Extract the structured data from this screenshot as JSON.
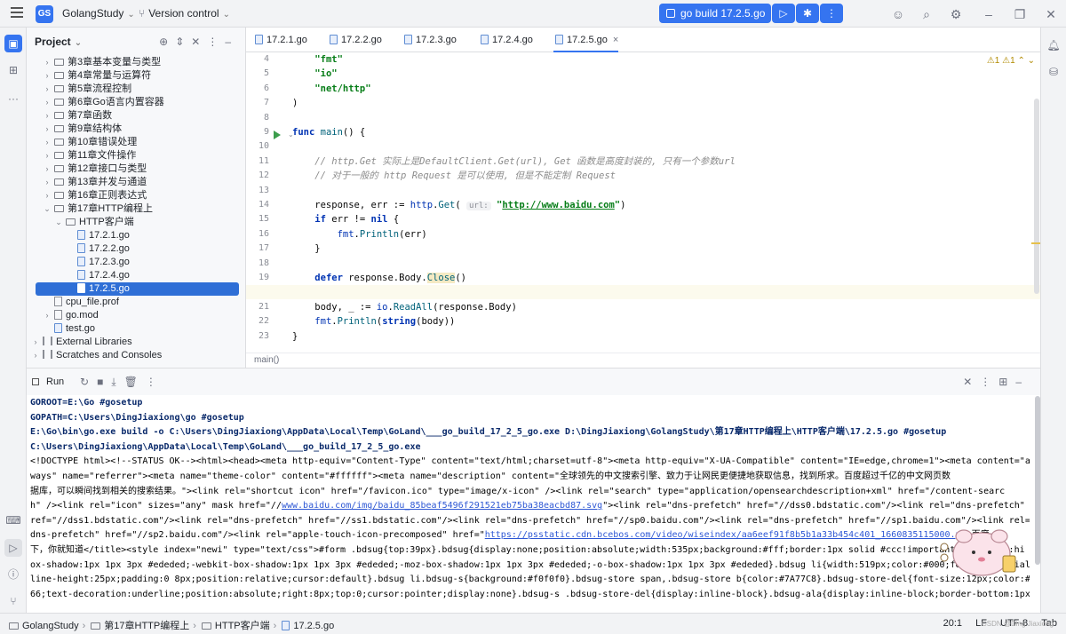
{
  "topbar": {
    "project_badge": "GS",
    "project_name": "GolangStudy",
    "vcs": "Version control",
    "run_config": "go build 17.2.5.go"
  },
  "icons": {
    "menu": "hamburger-icon",
    "run": "play-icon",
    "debug": "bug-icon",
    "more": "kebab-icon",
    "user": "user-icon",
    "search": "search-icon",
    "settings": "gear-icon"
  },
  "project_panel": {
    "title": "Project",
    "tree": [
      {
        "depth": 1,
        "arrow": "›",
        "kind": "folder",
        "label": "第3章基本变量与类型"
      },
      {
        "depth": 1,
        "arrow": "›",
        "kind": "folder",
        "label": "第4章常量与运算符"
      },
      {
        "depth": 1,
        "arrow": "›",
        "kind": "folder",
        "label": "第5章流程控制"
      },
      {
        "depth": 1,
        "arrow": "›",
        "kind": "folder",
        "label": "第6章Go语言内置容器"
      },
      {
        "depth": 1,
        "arrow": "›",
        "kind": "folder",
        "label": "第7章函数"
      },
      {
        "depth": 1,
        "arrow": "›",
        "kind": "folder",
        "label": "第9章结构体"
      },
      {
        "depth": 1,
        "arrow": "›",
        "kind": "folder",
        "label": "第10章错误处理"
      },
      {
        "depth": 1,
        "arrow": "›",
        "kind": "folder",
        "label": "第11章文件操作"
      },
      {
        "depth": 1,
        "arrow": "›",
        "kind": "folder",
        "label": "第12章接口与类型"
      },
      {
        "depth": 1,
        "arrow": "›",
        "kind": "folder",
        "label": "第13章并发与通道"
      },
      {
        "depth": 1,
        "arrow": "›",
        "kind": "folder",
        "label": "第16章正则表达式"
      },
      {
        "depth": 1,
        "arrow": "⌄",
        "kind": "folder",
        "label": "第17章HTTP编程上"
      },
      {
        "depth": 2,
        "arrow": "⌄",
        "kind": "folder",
        "label": "HTTP客户端"
      },
      {
        "depth": 3,
        "arrow": "",
        "kind": "go",
        "label": "17.2.1.go"
      },
      {
        "depth": 3,
        "arrow": "",
        "kind": "go",
        "label": "17.2.2.go"
      },
      {
        "depth": 3,
        "arrow": "",
        "kind": "go",
        "label": "17.2.3.go"
      },
      {
        "depth": 3,
        "arrow": "",
        "kind": "go",
        "label": "17.2.4.go"
      },
      {
        "depth": 3,
        "arrow": "",
        "kind": "go",
        "label": "17.2.5.go",
        "selected": true
      },
      {
        "depth": 1,
        "arrow": "",
        "kind": "doc",
        "label": "cpu_file.prof"
      },
      {
        "depth": 1,
        "arrow": "›",
        "kind": "doc",
        "label": "go.mod"
      },
      {
        "depth": 1,
        "arrow": "",
        "kind": "go",
        "label": "test.go"
      },
      {
        "depth": 0,
        "arrow": "›",
        "kind": "lib",
        "label": "External Libraries"
      },
      {
        "depth": 0,
        "arrow": "›",
        "kind": "lib",
        "label": "Scratches and Consoles"
      }
    ]
  },
  "editor": {
    "tabs": [
      "17.2.1.go",
      "17.2.2.go",
      "17.2.3.go",
      "17.2.4.go",
      "17.2.5.go"
    ],
    "active_tab": 4,
    "tab_close": "×",
    "warnings": "⚠1  ⚠1  ⌃  ⌄",
    "line_numbers": [
      "4",
      "5",
      "6",
      "7",
      "8",
      "9",
      "10",
      "11",
      "12",
      "13",
      "14",
      "15",
      "16",
      "17",
      "18",
      "19",
      "20",
      "21",
      "22",
      "23"
    ],
    "breadcrumb": "main()"
  },
  "run_panel": {
    "title": "Run"
  },
  "console": {
    "l1": "GOROOT=E:\\Go #gosetup",
    "l2": "GOPATH=C:\\Users\\DingJiaxiong\\go #gosetup",
    "l3": "E:\\Go\\bin\\go.exe build -o C:\\Users\\DingJiaxiong\\AppData\\Local\\Temp\\GoLand\\___go_build_17_2_5_go.exe D:\\DingJiaxiong\\GolangStudy\\第17章HTTP编程上\\HTTP客户端\\17.2.5.go #gosetup",
    "l4": "C:\\Users\\DingJiaxiong\\AppData\\Local\\Temp\\GoLand\\___go_build_17_2_5_go.exe",
    "l5": "<!DOCTYPE html><!--STATUS OK--><html><head><meta http-equiv=\"Content-Type\" content=\"text/html;charset=utf-8\"><meta http-equiv=\"X-UA-Compatible\" content=\"IE=edge,chrome=1\"><meta content=\"al",
    "l6": "ways\" name=\"referrer\"><meta name=\"theme-color\" content=\"#ffffff\"><meta name=\"description\" content=\"全球领先的中文搜索引擎、致力于让网民更便捷地获取信息，找到所求。百度超过千亿的中文网页数",
    "l7": "据库，可以瞬间找到相关的搜索结果。\"><link rel=\"shortcut icon\" href=\"/favicon.ico\" type=\"image/x-icon\" /><link rel=\"search\" type=\"application/opensearchdescription+xml\" href=\"/content-searc",
    "l8a": "h\" /><link rel=\"icon\" sizes=\"any\" mask href=\"//",
    "l8link": "www.baidu.com/img/baidu_85beaf5496f291521eb75ba38eacbd87.svg",
    "l8b": "\"><link rel=\"dns-prefetch\" href=\"//dss0.bdstatic.com\"/><link rel=\"dns-prefetch\"",
    "l9": "ref=\"//dss1.bdstatic.com\"/><link rel=\"dns-prefetch\" href=\"//ss1.bdstatic.com\"/><link rel=\"dns-prefetch\" href=\"//sp0.baidu.com\"/><link rel=\"dns-prefetch\" href=\"//sp1.baidu.com\"/><link rel=\"",
    "l10a": "dns-prefetch\" href=\"//sp2.baidu.com\"/><link rel=\"apple-touch-icon-precomposed\" href=\"",
    "l10link": "https://psstatic.cdn.bcebos.com/video/wiseindex/aa6eef91f8b5b1a33b454c401_1660835115000.p",
    "l10b": "  百度",
    "l11": "下，你就知道</title><style index=\"newi\" type=\"text/css\">#form .bdsug{top:39px}.bdsug{display:none;position:absolute;width:535px;background:#fff;border:1px solid #ccc!important;_overflow:hi",
    "l12": "ox-shadow:1px 1px 3px #ededed;-webkit-box-shadow:1px 1px 3px #ededed;-moz-box-shadow:1px 1px 3px #ededed;-o-box-shadow:1px 1px 3px #ededed}.bdsug li{width:519px;color:#000;font:14px arial;",
    "l13": "line-height:25px;padding:0 8px;position:relative;cursor:default}.bdsug li.bdsug-s{background:#f0f0f0}.bdsug-store span,.bdsug-store b{color:#7A77C8}.bdsug-store-del{font-size:12px;color:#6",
    "l14": "66;text-decoration:underline;position:absolute;right:8px;top:0;cursor:pointer;display:none}.bdsug-s .bdsug-store-del{display:inline-block}.bdsug-ala{display:inline-block;border-bottom:1px"
  },
  "statusbar": {
    "crumbs": [
      "GolangStudy",
      "第17章HTTP编程上",
      "HTTP客户端",
      "17.2.5.go"
    ],
    "position": "20:1",
    "line_sep": "LF",
    "encoding": "UTF-8",
    "indent": "Tab"
  },
  "watermark": "CSDN @Ding Jiaxiong",
  "colors": {
    "accent": "#3574f0",
    "selection": "#2f6fd6",
    "keyword": "#0033b3",
    "string": "#067d17",
    "comment": "#8c8c8c"
  }
}
